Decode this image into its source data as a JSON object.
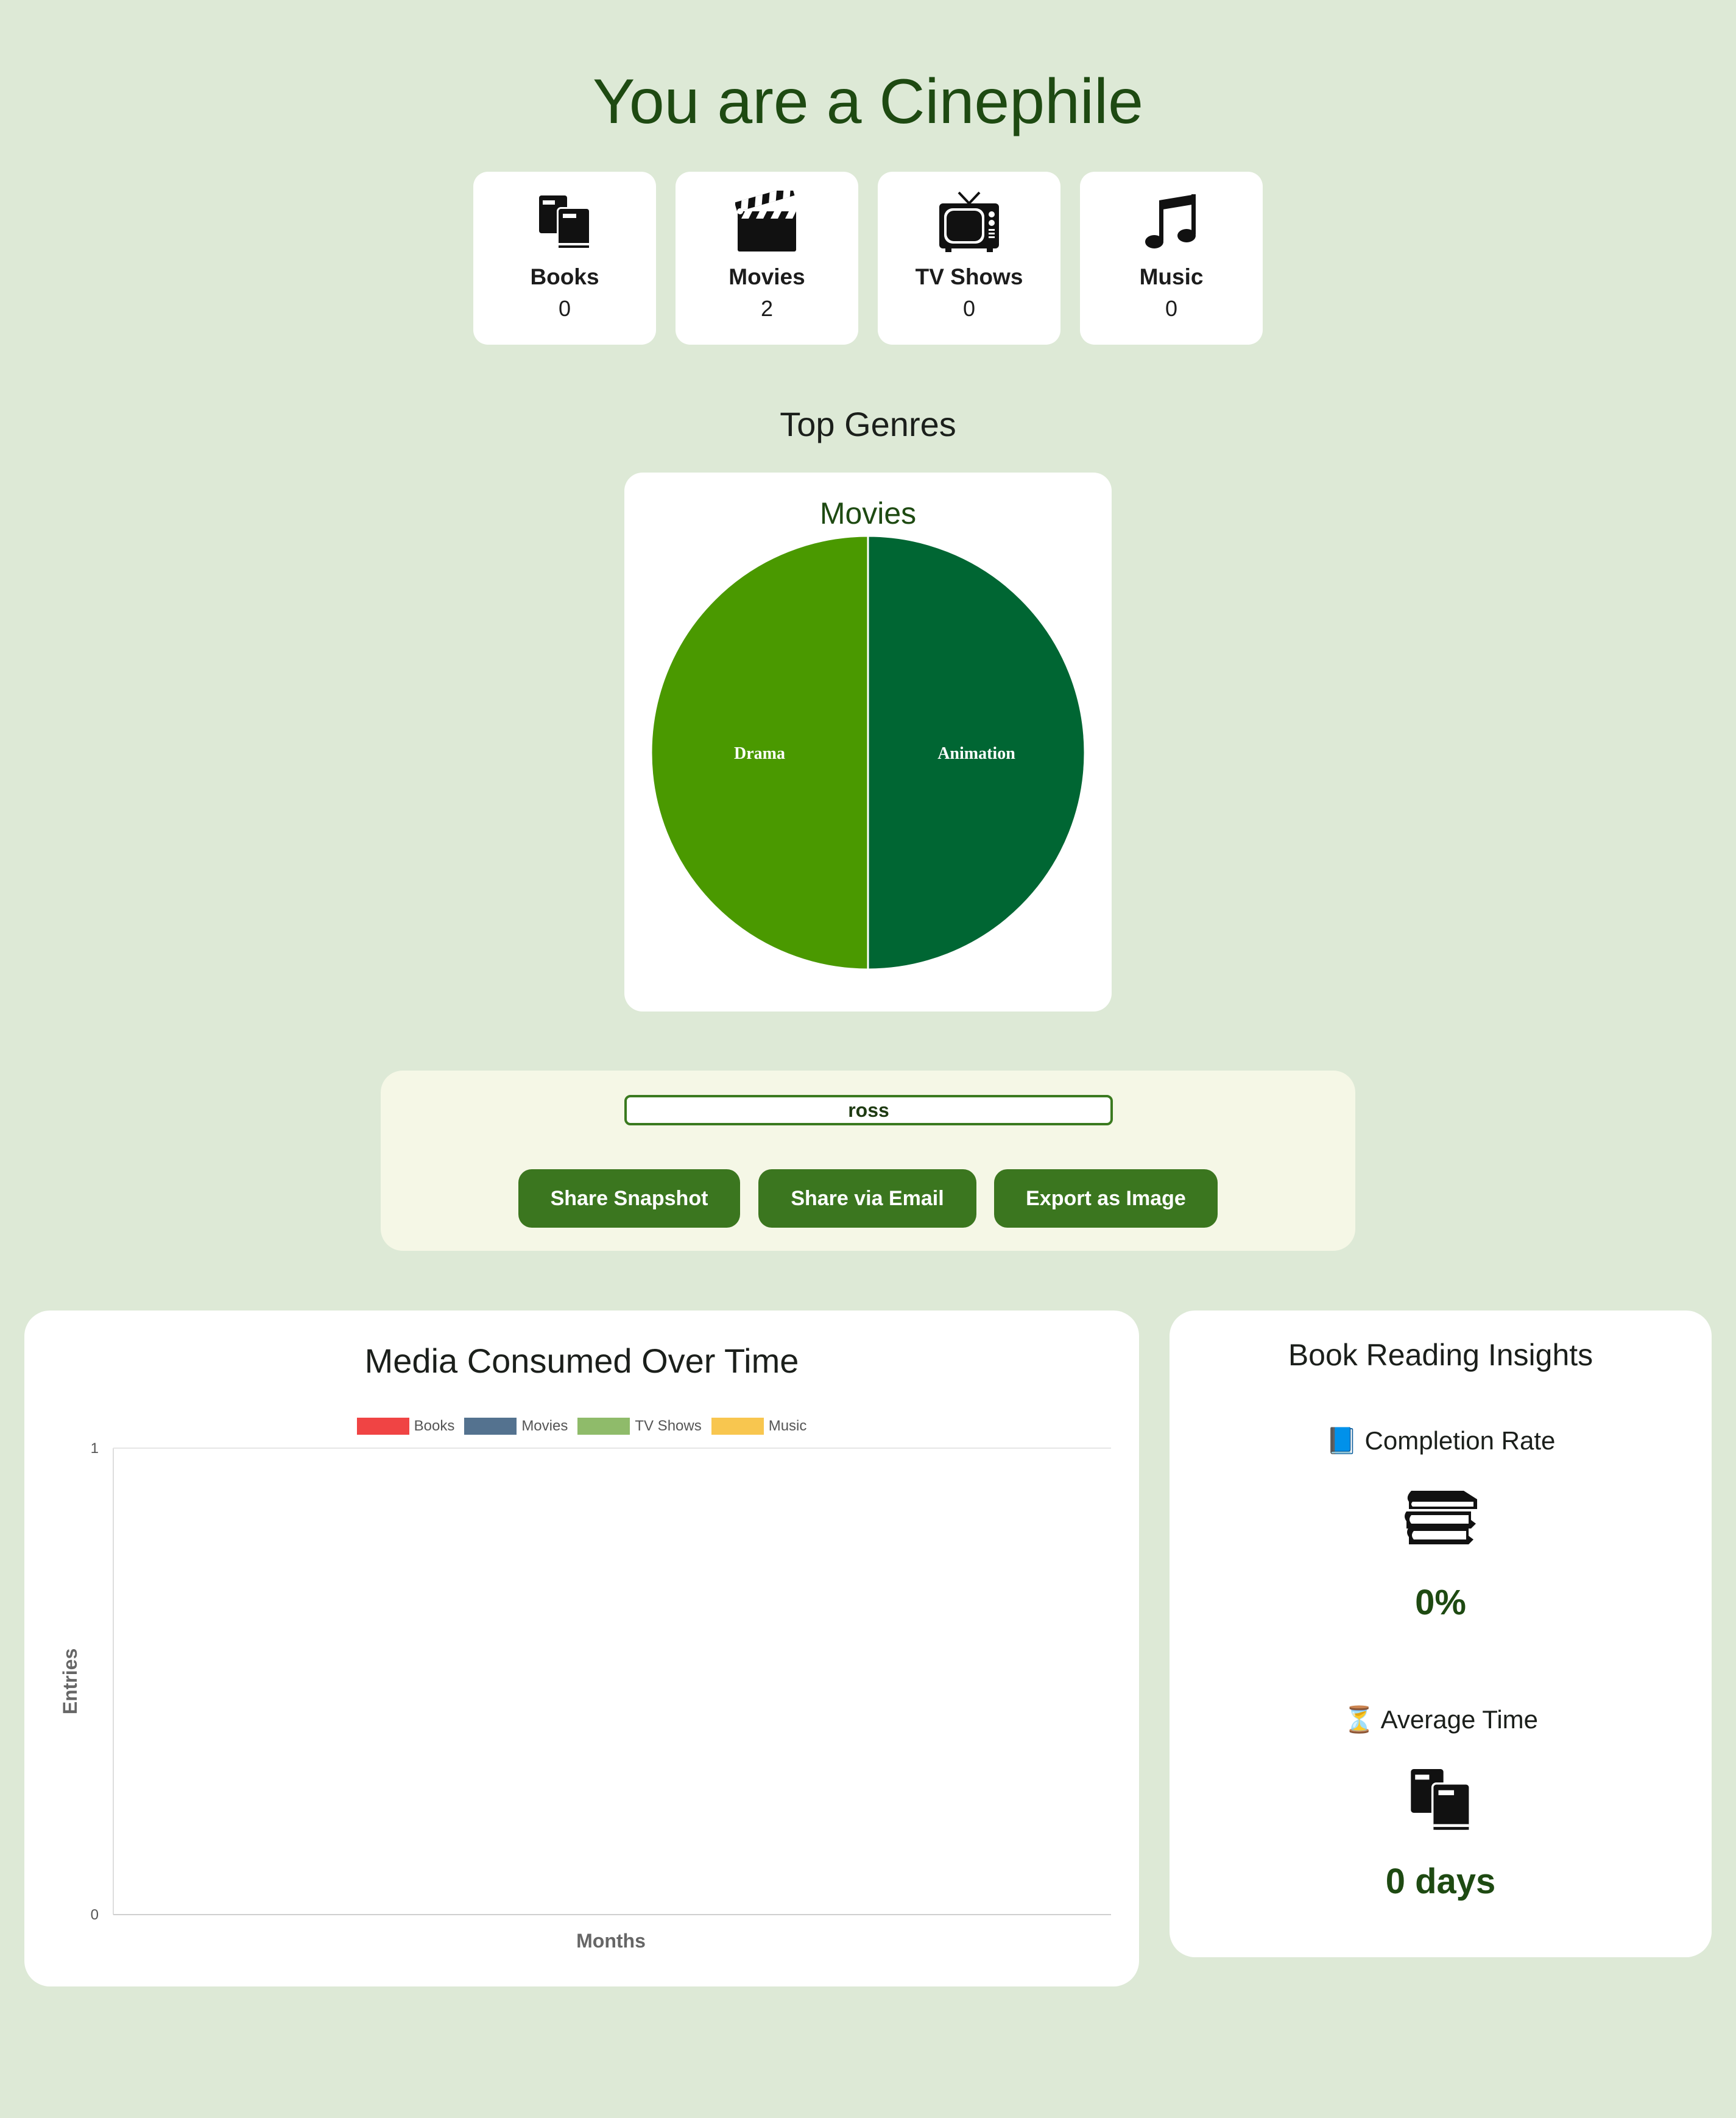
{
  "header": {
    "title": "You are a Cinephile"
  },
  "stats": [
    {
      "label": "Books",
      "value": "0",
      "icon": "books-icon"
    },
    {
      "label": "Movies",
      "value": "2",
      "icon": "clapperboard-icon"
    },
    {
      "label": "TV Shows",
      "value": "0",
      "icon": "tv-icon"
    },
    {
      "label": "Music",
      "value": "0",
      "icon": "music-notes-icon"
    }
  ],
  "top_genres": {
    "section_title": "Top Genres",
    "card_title": "Movies"
  },
  "share": {
    "name_value": "ross",
    "buttons": [
      "Share Snapshot",
      "Share via Email",
      "Export as Image"
    ]
  },
  "media_chart": {
    "title": "Media Consumed Over Time",
    "legend": [
      "Books",
      "Movies",
      "TV Shows",
      "Music"
    ]
  },
  "insights": {
    "title": "Book Reading Insights",
    "completion_label": "📘 Completion Rate",
    "completion_value": "0%",
    "avg_label": "⏳ Average Time",
    "avg_value": "0 days"
  },
  "colors": {
    "background": "#dde9d6",
    "accent": "#3b761f",
    "heading": "#1e4a12",
    "books": "#f04444",
    "movies": "#54728f",
    "tv_shows": "#8fbb6a",
    "music": "#f8c64f",
    "drama": "#4a9900",
    "animation": "#006633"
  },
  "chart_data": [
    {
      "type": "pie",
      "title": "Movies",
      "categories": [
        "Drama",
        "Animation"
      ],
      "values": [
        1,
        1
      ],
      "colors": [
        "#4a9900",
        "#006633"
      ]
    },
    {
      "type": "line",
      "title": "Media Consumed Over Time",
      "xlabel": "Months",
      "ylabel": "Entries",
      "ylim": [
        0,
        1
      ],
      "y_ticks": [
        "0",
        "1"
      ],
      "x": [],
      "series": [
        {
          "name": "Books",
          "values": [],
          "color": "#f04444"
        },
        {
          "name": "Movies",
          "values": [],
          "color": "#54728f"
        },
        {
          "name": "TV Shows",
          "values": [],
          "color": "#8fbb6a"
        },
        {
          "name": "Music",
          "values": [],
          "color": "#f8c64f"
        }
      ],
      "legend_position": "top-center",
      "grid": false
    }
  ]
}
